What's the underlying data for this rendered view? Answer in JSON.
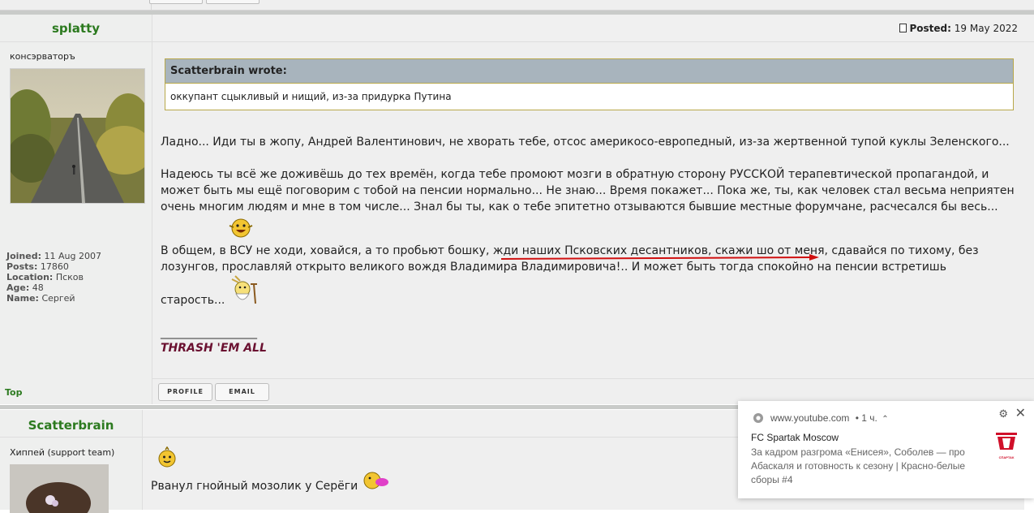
{
  "post1": {
    "author": "splatty",
    "rank": "консэрваторъ",
    "stats": {
      "joined_label": "Joined:",
      "joined": "11 Aug 2007",
      "posts_label": "Posts:",
      "posts": "17860",
      "location_label": "Location:",
      "location": "Псков",
      "age_label": "Age:",
      "age": "48",
      "name_label": "Name:",
      "name": "Сергей"
    },
    "posted_label": "Posted:",
    "posted_date": "19 May 2022",
    "quote_header": "Scatterbrain wrote:",
    "quote_text": "оккупант сцыкливый и нищий, из-за придурка Путина",
    "paragraph1": "Ладно... Иди ты в жопу, Андрей Валентинович, не хворать тебе, отсос америкосо-европедный, из-за жертвенной тупой куклы Зеленского...",
    "paragraph2": "Надеюсь ты всё же доживёшь до тех времён, когда тебе промоют мозги в обратную сторону РУССКОЙ терапевтической пропагандой, и может быть мы ещё поговорим с тобой на пенсии нормально... Не знаю... Время покажет... Пока же, ты, как человек стал весьма неприятен очень многим людям и мне в том числе... Знал бы ты, как о тебе эпитетно отзываются бывшие местные форумчане, расчесался бы весь...",
    "paragraph3a": "В общем, в ВСУ не ходи, ховайся, а то пробьют бошку, жди наших Псковских десантников, скажи шо от меня, сдавайся по тихому, без лозунгов, прославляй открыто великого вождя Владимира Владимировича!..  И может быть тогда спокойно на пенсии встретишь",
    "paragraph3b": "старость...",
    "sig_line": "_________________",
    "sig": "THRASH 'EM ALL",
    "top_link": "Top",
    "profile_btn": "PROFILE",
    "email_btn": "EMAIL"
  },
  "post2": {
    "author": "Scatterbrain",
    "rank": "Хиппей (support team)",
    "text": "Рванул гнойный мозолик у Серёги"
  },
  "notification": {
    "source": "www.youtube.com",
    "time": "• 1 ч.",
    "title": "FC Spartak Moscow",
    "text": "За кадром разгрома «Енисея», Соболев — про Абаскаля и готовность к сезону | Красно-белые сборы #4",
    "logo_text": "СПАРТАК"
  },
  "colors": {
    "author": "#2c7a1f",
    "signature": "#6a1030",
    "quote_header_bg": "#a8b4bd",
    "arrow": "#d01010"
  }
}
